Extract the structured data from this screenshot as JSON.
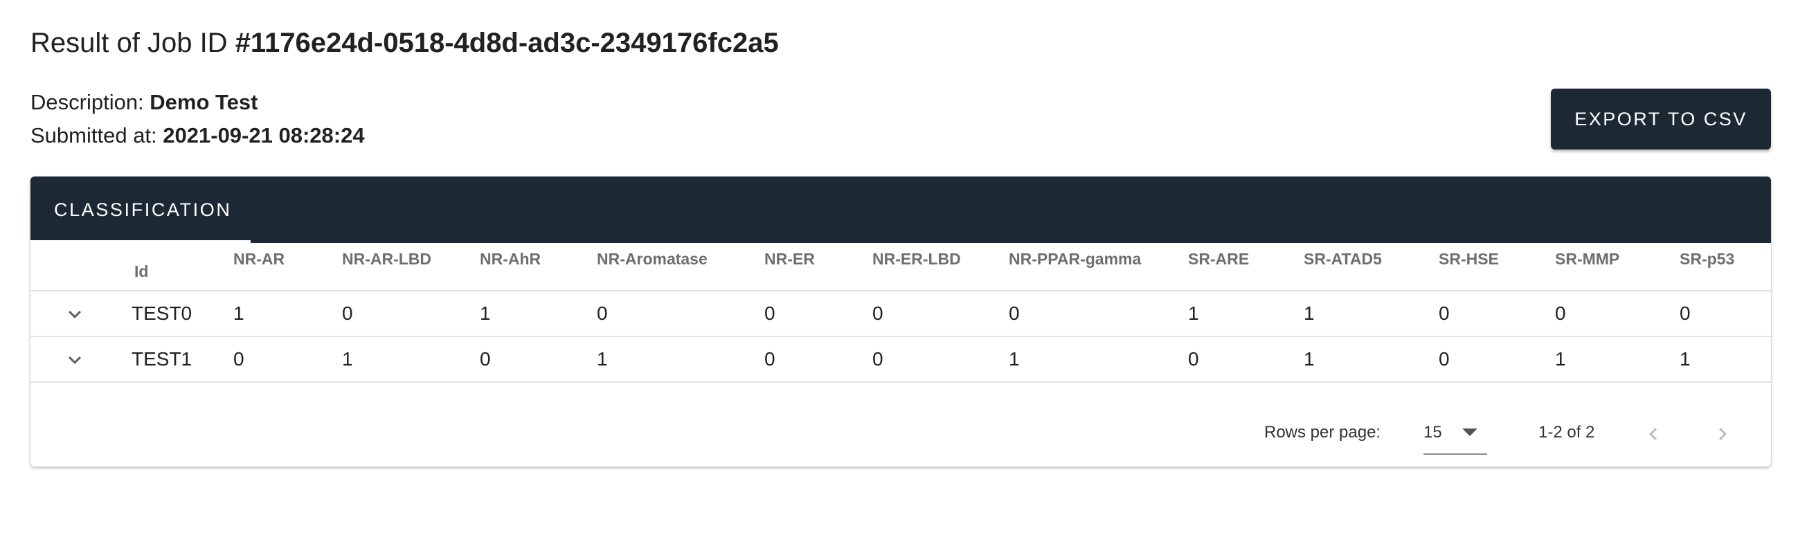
{
  "page": {
    "title_prefix": "Result of Job ID ",
    "job_id": "#1176e24d-0518-4d8d-ad3c-2349176fc2a5",
    "description_label": "Description: ",
    "description_value": "Demo Test",
    "submitted_label": "Submitted at: ",
    "submitted_value": "2021-09-21 08:28:24",
    "export_label": "EXPORT TO CSV"
  },
  "tabs": [
    {
      "label": "CLASSIFICATION",
      "active": true
    }
  ],
  "table": {
    "id_header": "Id",
    "columns": [
      "NR-AR",
      "NR-AR-LBD",
      "NR-AhR",
      "NR-Aromatase",
      "NR-ER",
      "NR-ER-LBD",
      "NR-PPAR-gamma",
      "SR-ARE",
      "SR-ATAD5",
      "SR-HSE",
      "SR-MMP",
      "SR-p53"
    ],
    "rows": [
      {
        "id": "TEST0",
        "values": [
          "1",
          "0",
          "1",
          "0",
          "0",
          "0",
          "0",
          "1",
          "1",
          "0",
          "0",
          "0"
        ]
      },
      {
        "id": "TEST1",
        "values": [
          "0",
          "1",
          "0",
          "1",
          "0",
          "0",
          "1",
          "0",
          "1",
          "0",
          "1",
          "1"
        ]
      }
    ]
  },
  "pagination": {
    "rows_per_page_label": "Rows per page:",
    "rows_per_page_value": "15",
    "range_text": "1-2 of 2"
  },
  "icons": {
    "row_expand": "chevron-down-icon",
    "select_arrow": "arrow-drop-down-icon",
    "prev": "chevron-left-icon",
    "next": "chevron-right-icon"
  },
  "colors": {
    "primary_dark": "#1c2935",
    "header_text": "#6e6e6e",
    "divider": "#e2e2e2",
    "disabled_icon": "#bdbdbd"
  }
}
